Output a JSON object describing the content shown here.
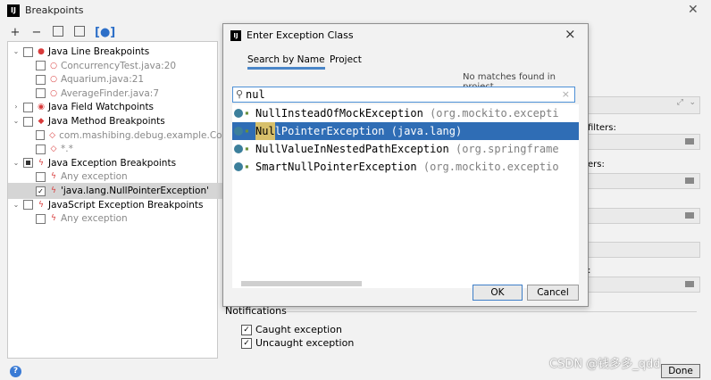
{
  "window": {
    "title": "Breakpoints",
    "logo": "IJ"
  },
  "toolbar": {
    "add": "+",
    "remove": "−"
  },
  "tree": [
    {
      "label": "Java Line Breakpoints",
      "level": 0,
      "expander": "v",
      "check": "",
      "icon": "red-dot-icon",
      "dim": false
    },
    {
      "label": "ConcurrencyTest.java:20",
      "level": 1,
      "check": "",
      "icon": "red-circle-icon",
      "dim": true
    },
    {
      "label": "Aquarium.java:21",
      "level": 1,
      "check": "",
      "icon": "red-circle-icon",
      "dim": true
    },
    {
      "label": "AverageFinder.java:7",
      "level": 1,
      "check": "",
      "icon": "red-circle-icon",
      "dim": true
    },
    {
      "label": "Java Field Watchpoints",
      "level": 0,
      "expander": ">",
      "check": "",
      "icon": "eye-icon",
      "dim": false
    },
    {
      "label": "Java Method Breakpoints",
      "level": 0,
      "expander": "v",
      "check": "",
      "icon": "red-diamond-icon",
      "dim": false
    },
    {
      "label": "com.mashibing.debug.example.Concur",
      "level": 1,
      "check": "",
      "icon": "red-diamond-outline-icon",
      "dim": true
    },
    {
      "label": "*.*",
      "level": 1,
      "check": "",
      "icon": "red-diamond-outline-icon",
      "dim": true
    },
    {
      "label": "Java Exception Breakpoints",
      "level": 0,
      "expander": "v",
      "check": "part",
      "icon": "lightning-icon",
      "dim": false
    },
    {
      "label": "Any exception",
      "level": 1,
      "check": "",
      "icon": "lightning-icon",
      "dim": true
    },
    {
      "label": "'java.lang.NullPointerException'",
      "level": 1,
      "check": "✓",
      "icon": "lightning-icon",
      "dim": false,
      "selected": true
    },
    {
      "label": "JavaScript Exception Breakpoints",
      "level": 0,
      "expander": "v",
      "check": "",
      "icon": "lightning-icon",
      "dim": false
    },
    {
      "label": "Any exception",
      "level": 1,
      "check": "",
      "icon": "lightning-icon",
      "dim": true
    }
  ],
  "side_labels": {
    "filters": "filters:",
    "ers": "ers:",
    "colon": ":"
  },
  "notifications": {
    "title": "Notifications",
    "caught": "Caught exception",
    "uncaught": "Uncaught exception"
  },
  "dialog": {
    "title": "Enter Exception Class",
    "tab_name": "Search by Name",
    "tab_project": "Project",
    "no_matches": "No matches found in project",
    "search_value": "nul",
    "results": [
      {
        "match": "",
        "rest": "NullInsteadOfMockException",
        "pkg": "(org.mockito.excepti",
        "pre": ""
      },
      {
        "match": "Nul",
        "rest": "lPointerException",
        "pkg": "(java.lang)",
        "selected": true
      },
      {
        "match": "",
        "rest": "NullValueInNestedPathException",
        "pkg": "(org.springframe"
      },
      {
        "match": "",
        "rest": "SmartNullPointerException",
        "pkg": "(org.mockito.exceptio"
      }
    ],
    "ok": "OK",
    "cancel": "Cancel",
    "close": "×"
  },
  "footer": {
    "help": "?",
    "done": "Done",
    "watermark": "CSDN @钱多多_qdd"
  },
  "colors": {
    "selection": "#2f6db5",
    "match_highlight": "#d7c06b",
    "focus": "#4d90d6"
  }
}
